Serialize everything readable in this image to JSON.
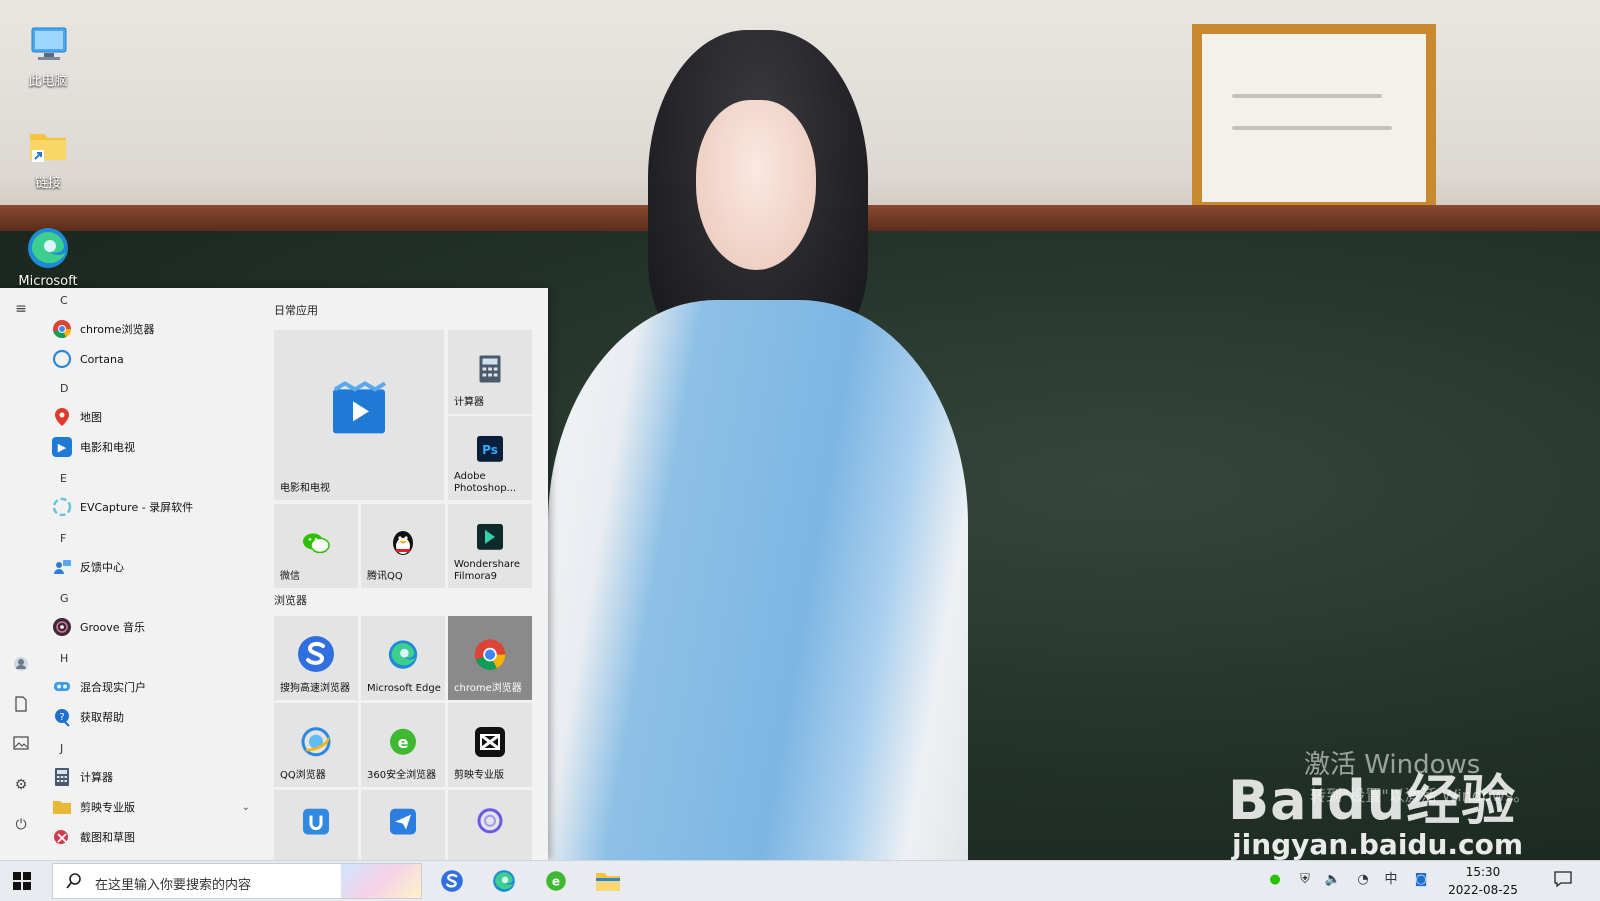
{
  "desktop": {
    "icons": [
      {
        "label": "此电脑",
        "icon": "computer-icon"
      },
      {
        "label": "链接",
        "icon": "folder-shortcut-icon"
      },
      {
        "label": "Microsoft",
        "icon": "edge-icon"
      }
    ]
  },
  "start_menu": {
    "app_list": [
      {
        "type": "letter",
        "text": "C"
      },
      {
        "type": "app",
        "label": "chrome浏览器",
        "icon": "chrome-icon",
        "color": "#db4437"
      },
      {
        "type": "app",
        "label": "Cortana",
        "icon": "cortana-icon",
        "color": "#2b88d8"
      },
      {
        "type": "letter",
        "text": "D"
      },
      {
        "type": "app",
        "label": "地图",
        "icon": "map-pin-icon",
        "color": "#e03a2e"
      },
      {
        "type": "app",
        "label": "电影和电视",
        "icon": "video-play-icon",
        "color": "#1f7ad6"
      },
      {
        "type": "letter",
        "text": "E"
      },
      {
        "type": "app",
        "label": "EVCapture - 录屏软件",
        "icon": "evcapture-icon",
        "color": "#6bc5d9"
      },
      {
        "type": "letter",
        "text": "F"
      },
      {
        "type": "app",
        "label": "反馈中心",
        "icon": "feedback-icon",
        "color": "#2f7bd9"
      },
      {
        "type": "letter",
        "text": "G"
      },
      {
        "type": "app",
        "label": "Groove 音乐",
        "icon": "groove-music-icon",
        "color": "#3a2a3a"
      },
      {
        "type": "letter",
        "text": "H"
      },
      {
        "type": "app",
        "label": "混合现实门户",
        "icon": "mixed-reality-icon",
        "color": "#3a9be0"
      },
      {
        "type": "app",
        "label": "获取帮助",
        "icon": "help-icon",
        "color": "#1f6fcf"
      },
      {
        "type": "letter",
        "text": "J"
      },
      {
        "type": "app",
        "label": "计算器",
        "icon": "calculator-icon",
        "color": "#4a5a6a"
      },
      {
        "type": "app",
        "label": "剪映专业版",
        "icon": "folder-icon",
        "color": "#e8b838",
        "expand": "⌄"
      },
      {
        "type": "app",
        "label": "截图和草图",
        "icon": "snip-sketch-icon",
        "color": "#d23a4a"
      }
    ],
    "groups": [
      {
        "title": "日常应用"
      },
      {
        "title": "浏览器"
      }
    ],
    "tiles": [
      {
        "label": "电影和电视",
        "icon": "video-play-icon"
      },
      {
        "label": "计算器",
        "icon": "calculator-icon"
      },
      {
        "label": "Adobe Photoshop...",
        "icon": "photoshop-icon"
      },
      {
        "label": "微信",
        "icon": "wechat-icon"
      },
      {
        "label": "腾讯QQ",
        "icon": "qq-penguin-icon"
      },
      {
        "label": "Wondershare Filmora9",
        "icon": "filmora-icon"
      },
      {
        "label": "搜狗高速浏览器",
        "icon": "sogou-browser-icon"
      },
      {
        "label": "Microsoft Edge",
        "icon": "edge-icon"
      },
      {
        "label": "chrome浏览器",
        "icon": "chrome-icon",
        "selected": true
      },
      {
        "label": "QQ浏览器",
        "icon": "qq-browser-icon"
      },
      {
        "label": "360安全浏览器",
        "icon": "360-browser-icon"
      },
      {
        "label": "剪映专业版",
        "icon": "capcut-icon"
      },
      {
        "label": "",
        "icon": "app-u-icon"
      },
      {
        "label": "",
        "icon": "paper-plane-icon"
      },
      {
        "label": "",
        "icon": "ring-app-icon"
      }
    ],
    "rail_icons": [
      "hamburger-menu-icon",
      "user-icon",
      "document-icon",
      "pictures-icon",
      "settings-gear-icon",
      "power-icon"
    ]
  },
  "taskbar": {
    "search_placeholder": "在这里输入你要搜索的内容",
    "pinned": [
      "sogou-browser-icon",
      "edge-icon",
      "360-browser-icon",
      "file-explorer-icon"
    ],
    "tray": [
      {
        "icon": "wechat-tray-icon",
        "glyph": "●"
      },
      {
        "icon": "security-shield-icon",
        "glyph": "⛨"
      },
      {
        "icon": "volume-icon",
        "glyph": "🔈"
      },
      {
        "icon": "wifi-icon",
        "glyph": "◔"
      },
      {
        "icon": "ime-chinese-icon",
        "glyph": "中"
      },
      {
        "icon": "qq-tray-icon",
        "glyph": "◙"
      }
    ],
    "time": "15:30",
    "date": "2022-08-25",
    "notification_icon": "notification-icon"
  },
  "watermark": {
    "activate_title": "激活 Windows",
    "activate_sub": "转到\"设置\"以激活 Windows。",
    "baidu_brand": "Baidu经验",
    "baidu_url": "jingyan.baidu.com"
  }
}
